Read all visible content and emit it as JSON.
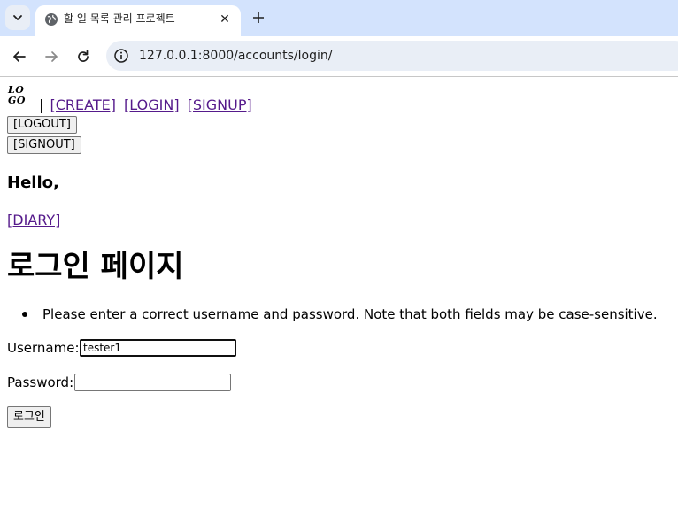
{
  "browser": {
    "tab_title": "할 일 목록 관리 프로젝트",
    "url": "127.0.0.1:8000/accounts/login/"
  },
  "site": {
    "logo_line1": "LO",
    "logo_line2": "GO",
    "separator": "|",
    "nav": {
      "create": "[CREATE]",
      "login": "[LOGIN]",
      "signup": "[SIGNUP]"
    },
    "logout_button": "[LOGOUT]",
    "signout_button": "[SIGNOUT]",
    "greeting": "Hello,",
    "diary_link": "[DIARY]"
  },
  "login_page": {
    "title": "로그인 페이지",
    "error": "Please enter a correct username and password. Note that both fields may be case-sensitive.",
    "username_label": "Username:",
    "username_value": "tester1",
    "password_label": "Password:",
    "password_value": "",
    "submit_label": "로그인"
  },
  "icons": {
    "tab_search": "chevron-down-icon",
    "favicon": "globe-icon",
    "close": "close-icon",
    "new_tab": "plus-icon",
    "back": "arrow-left-icon",
    "forward": "arrow-right-icon",
    "reload": "reload-icon",
    "site_info": "info-icon"
  },
  "colors": {
    "tabstrip": "#d3e3fd",
    "omnibox": "#e9eef6",
    "visited_link": "#551a8b"
  }
}
